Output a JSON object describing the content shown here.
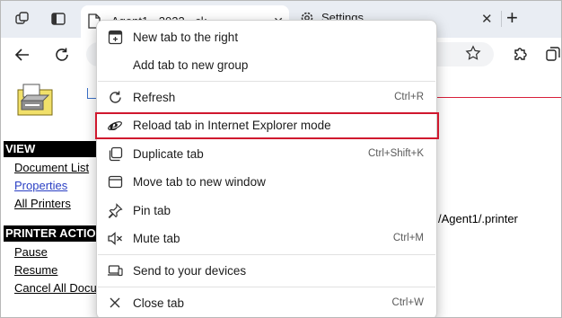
{
  "tabs": {
    "active_title": "Agent1 - 2022 - ck",
    "inactive_title": "Settings",
    "new_tab": "+"
  },
  "page": {
    "view_heading": "VIEW",
    "view_links": [
      "Document List",
      "Properties",
      "All Printers"
    ],
    "actions_heading": "PRINTER ACTIONS",
    "action_links": [
      "Pause",
      "Resume",
      "Cancel All Documents"
    ],
    "url_fragment": "/Agent1/.printer"
  },
  "context_menu": {
    "items": [
      {
        "label": "New tab to the right",
        "shortcut": "",
        "icon": "new-tab-icon"
      },
      {
        "label": "Add tab to new group",
        "shortcut": "",
        "icon": ""
      },
      {
        "label": "Refresh",
        "shortcut": "Ctrl+R",
        "icon": "refresh-icon"
      },
      {
        "label": "Reload tab in Internet Explorer mode",
        "shortcut": "",
        "icon": "internet-explorer-icon"
      },
      {
        "label": "Duplicate tab",
        "shortcut": "Ctrl+Shift+K",
        "icon": "duplicate-icon"
      },
      {
        "label": "Move tab to new window",
        "shortcut": "",
        "icon": "window-icon"
      },
      {
        "label": "Pin tab",
        "shortcut": "",
        "icon": "pin-icon"
      },
      {
        "label": "Mute tab",
        "shortcut": "Ctrl+M",
        "icon": "speaker-mute-icon"
      },
      {
        "label": "Send to your devices",
        "shortcut": "",
        "icon": "devices-icon"
      },
      {
        "label": "Close tab",
        "shortcut": "Ctrl+W",
        "icon": "close-icon"
      }
    ],
    "highlighted_item": "Reload tab in Internet Explorer mode"
  },
  "colors": {
    "highlight_border": "#d0182e",
    "tab_strip": "#e9edf3",
    "link_blue": "#2a3fc4"
  }
}
